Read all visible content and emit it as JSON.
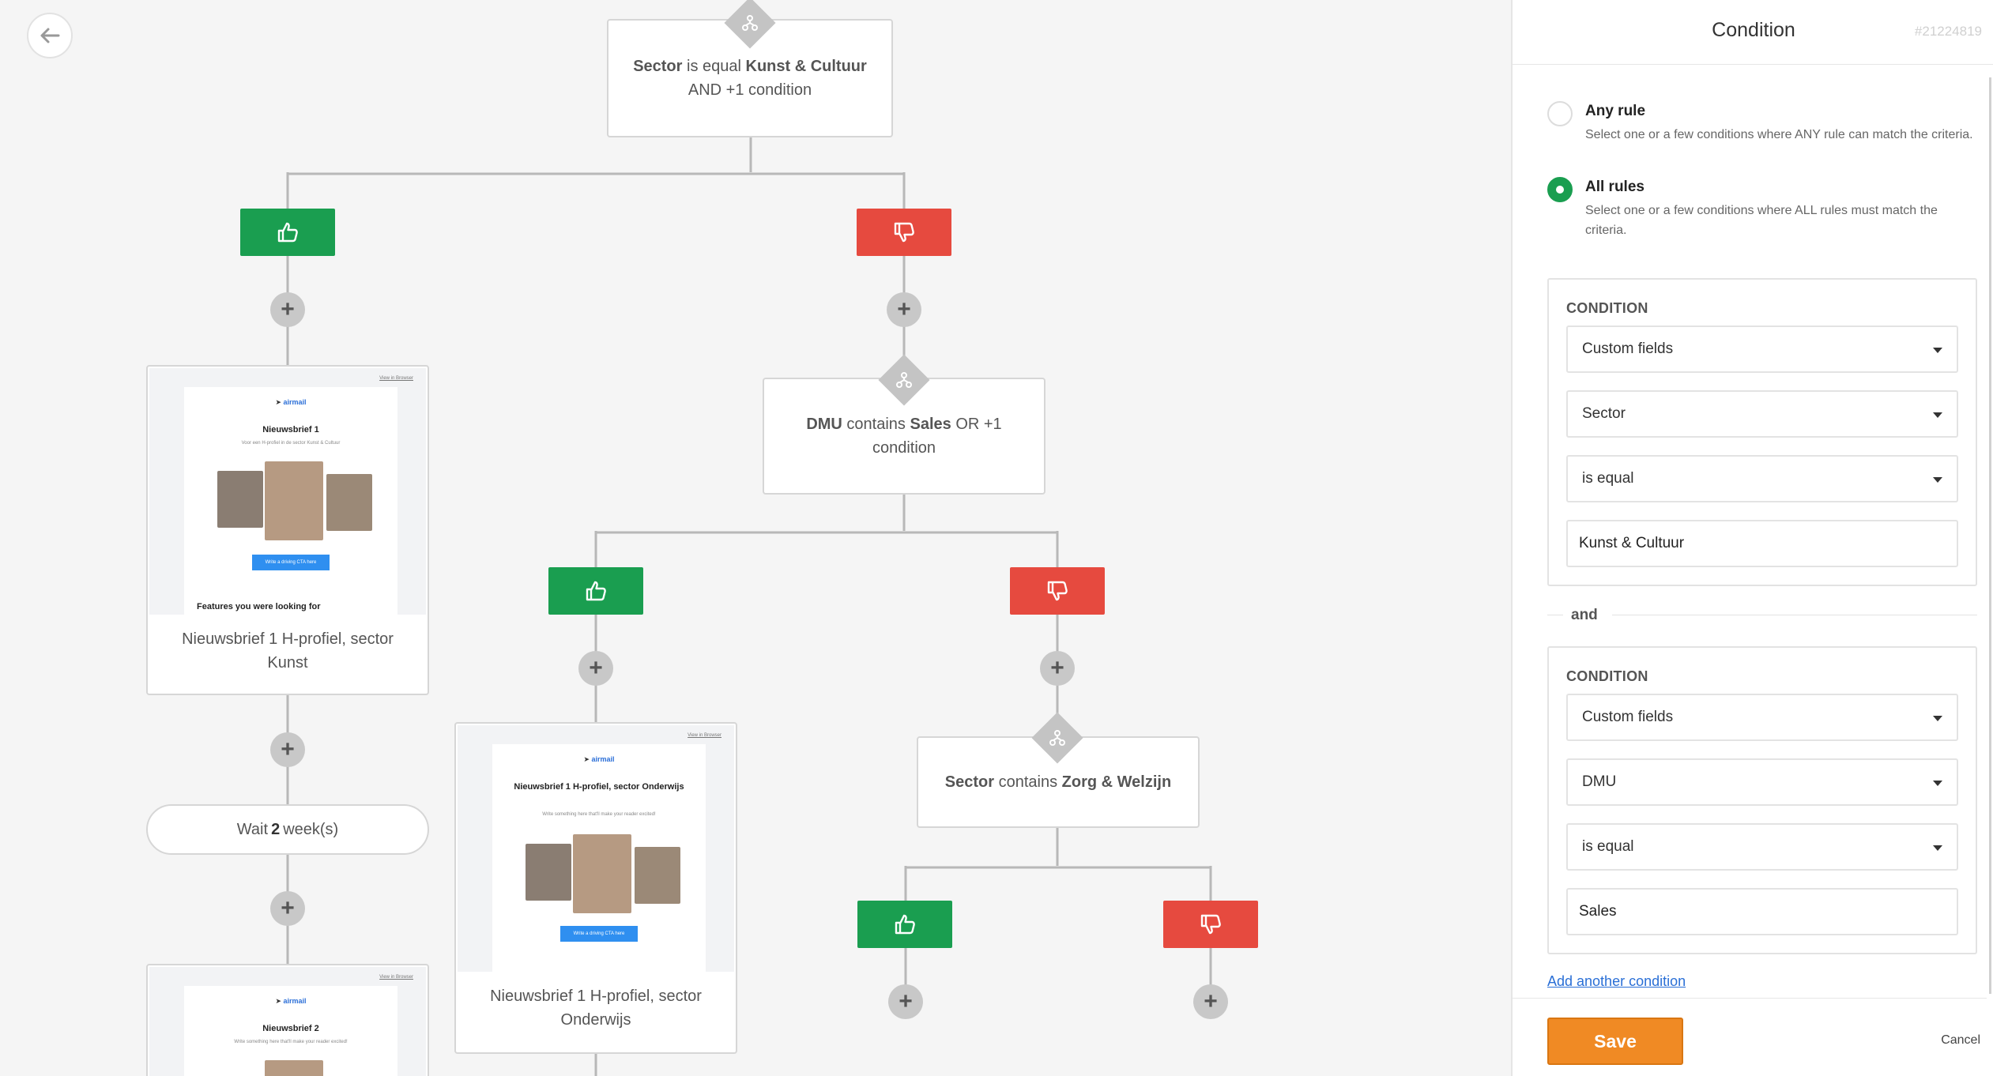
{
  "flow": {
    "condition1": {
      "field": "Sector",
      "op": "is equal",
      "value": "Kunst & Cultuur",
      "extra": "AND +1 condition"
    },
    "condition2": {
      "field": "DMU",
      "op": "contains",
      "value": "Sales",
      "extra": "OR +1 condition"
    },
    "condition3": {
      "field": "Sector",
      "op": "contains",
      "value": "Zorg & Welzijn"
    },
    "email1": {
      "label": "Nieuwsbrief 1 H-profiel, sector Kunst",
      "preview_title": "Nieuwsbrief 1",
      "preview_sub": "Voor een H-profiel in de sector Kunst & Cultuur",
      "preview_features": "Features you were looking for",
      "preview_cta": "Write a driving CTA here",
      "browser_link": "View in Browser",
      "logo": "airmail"
    },
    "email2": {
      "label": "Nieuwsbrief 1 H-profiel, sector Onderwijs",
      "preview_title": "Nieuwsbrief 1 H-profiel, sector Onderwijs",
      "preview_sub": "Write something here that'll make your reader excited!",
      "preview_cta": "Write a driving CTA here",
      "browser_link": "View in Browser",
      "logo": "airmail"
    },
    "email3": {
      "preview_title": "Nieuwsbrief 2",
      "preview_sub": "Write something here that'll make your reader excited!",
      "browser_link": "View in Browser",
      "logo": "airmail"
    },
    "wait": {
      "prefix": "Wait",
      "amount": "2",
      "unit": "week(s)"
    }
  },
  "panel": {
    "title": "Condition",
    "id": "#21224819",
    "match": {
      "any": {
        "title": "Any rule",
        "desc": "Select one or a few conditions where ANY rule can match the criteria.",
        "selected": false
      },
      "all": {
        "title": "All rules",
        "desc": "Select one or a few conditions where ALL rules must match the criteria.",
        "selected": true
      }
    },
    "conditions": [
      {
        "heading": "CONDITION",
        "source": "Custom fields",
        "field": "Sector",
        "operator": "is equal",
        "value": "Kunst & Cultuur"
      },
      {
        "heading": "CONDITION",
        "source": "Custom fields",
        "field": "DMU",
        "operator": "is equal",
        "value": "Sales"
      }
    ],
    "joiner": "and",
    "add_link": "Add another condition",
    "save": "Save",
    "cancel": "Cancel"
  },
  "colors": {
    "yes": "#1a9e50",
    "no": "#e64a3f",
    "save": "#f08a24",
    "link": "#2a6fd6"
  }
}
